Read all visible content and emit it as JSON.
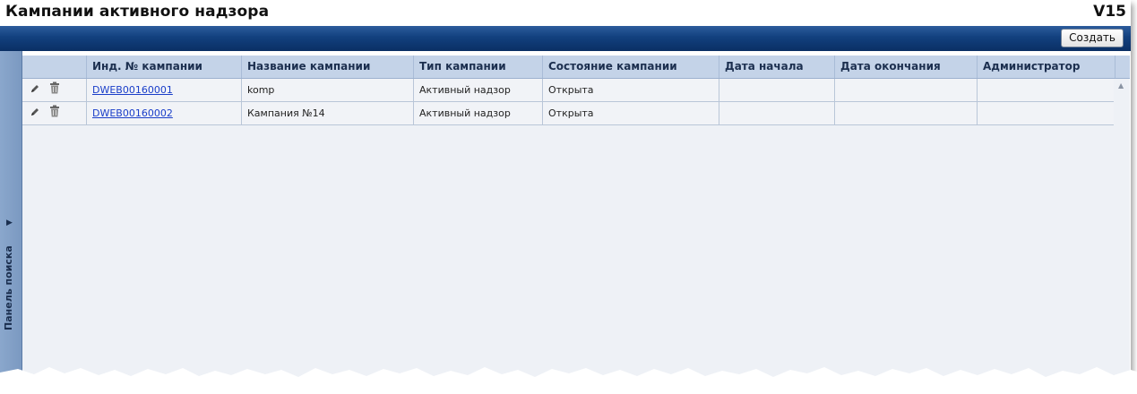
{
  "window": {
    "title": "Кампании активного надзора",
    "version": "V15"
  },
  "toolbar": {
    "create_label": "Создать"
  },
  "side_panel": {
    "label": "Панель поиска",
    "arrow": "▶"
  },
  "table": {
    "columns": [
      "Инд. № кампании",
      "Название кампании",
      "Тип кампании",
      "Состояние кампании",
      "Дата начала",
      "Дата окончания",
      "Администратор"
    ],
    "rows": [
      {
        "id": "DWEB00160001",
        "name": "komp",
        "type": "Активный надзор",
        "state": "Открыта",
        "start": "",
        "end": "",
        "admin": ""
      },
      {
        "id": "DWEB00160002",
        "name": "Кампания №14",
        "type": "Активный надзор",
        "state": "Открыта",
        "start": "",
        "end": "",
        "admin": ""
      }
    ]
  },
  "icons": {
    "edit": "pencil-icon",
    "delete": "trash-icon",
    "scroll_up": "scroll-up-arrow-icon"
  }
}
